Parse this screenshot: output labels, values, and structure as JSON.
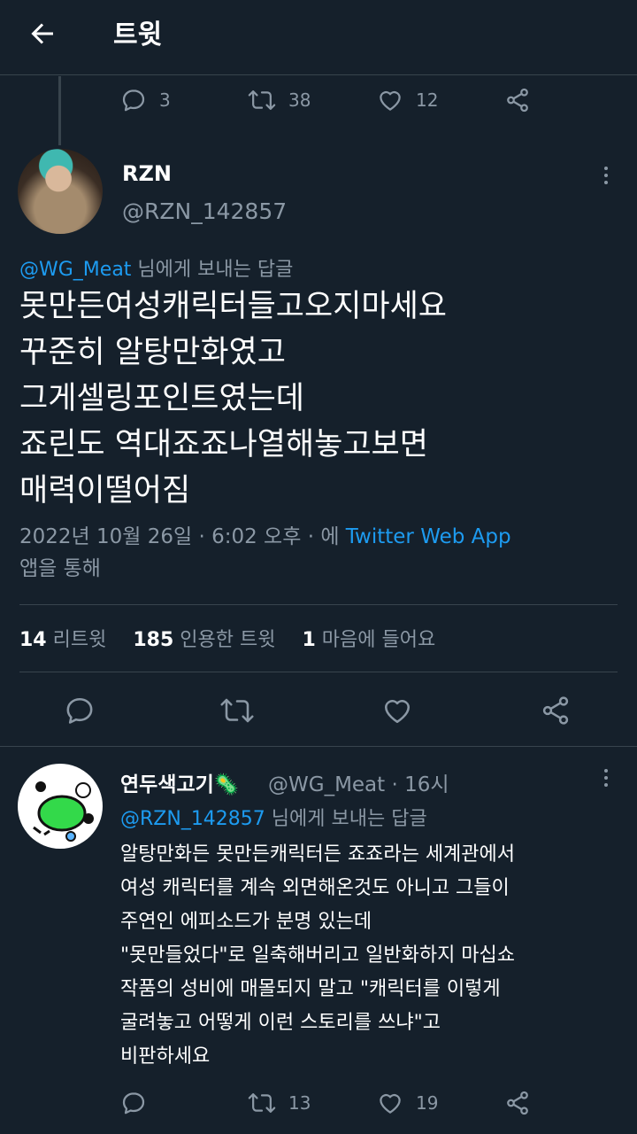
{
  "header": {
    "title": "트윗"
  },
  "prev_tweet_actions": {
    "replies": "3",
    "retweets": "38",
    "likes": "12"
  },
  "main_tweet": {
    "name": "RZN",
    "handle": "@RZN_142857",
    "reply_to_user": "@WG_Meat",
    "reply_to_suffix": " 님에게 보내는 답글",
    "text": "못만든여성캐릭터들고오지마세요\n꾸준히 알탕만화였고\n그게셀링포인트였는데\n죠린도 역대죠죠나열해놓고보면\n매력이떨어짐",
    "date": "2022년 10월 26일 · 6:02 오후 · 에 ",
    "source": "Twitter Web App",
    "source_suffix": "앱을 통해",
    "stats": {
      "retweets_count": "14",
      "retweets_label": " 리트윗",
      "quotes_count": "185",
      "quotes_label": " 인용한 트윗",
      "likes_count": "1",
      "likes_label": " 마음에 들어요"
    }
  },
  "reply_tweet": {
    "name": "연두색고기",
    "name_emoji": "🦠",
    "handle_time": "@WG_Meat · 16시",
    "reply_to_user": "@RZN_142857",
    "reply_to_suffix": " 님에게 보내는 답글",
    "text": "알탕만화든 못만든캐릭터든 죠죠라는 세계관에서\n여성 캐릭터를 계속 외면해온것도 아니고 그들이\n주연인 에피소드가 분명 있는데\n\"못만들었다\"로 일축해버리고 일반화하지 마십쇼\n작품의 성비에 매몰되지 말고 \"캐릭터를 이렇게\n굴려놓고 어떻게 이런 스토리를 쓰냐\"고\n비판하세요",
    "actions": {
      "replies": "",
      "retweets": "13",
      "likes": "19"
    }
  },
  "colors": {
    "background": "#15202b",
    "muted": "#8b98a5",
    "link": "#1d9bf0",
    "divider": "#38444d"
  }
}
